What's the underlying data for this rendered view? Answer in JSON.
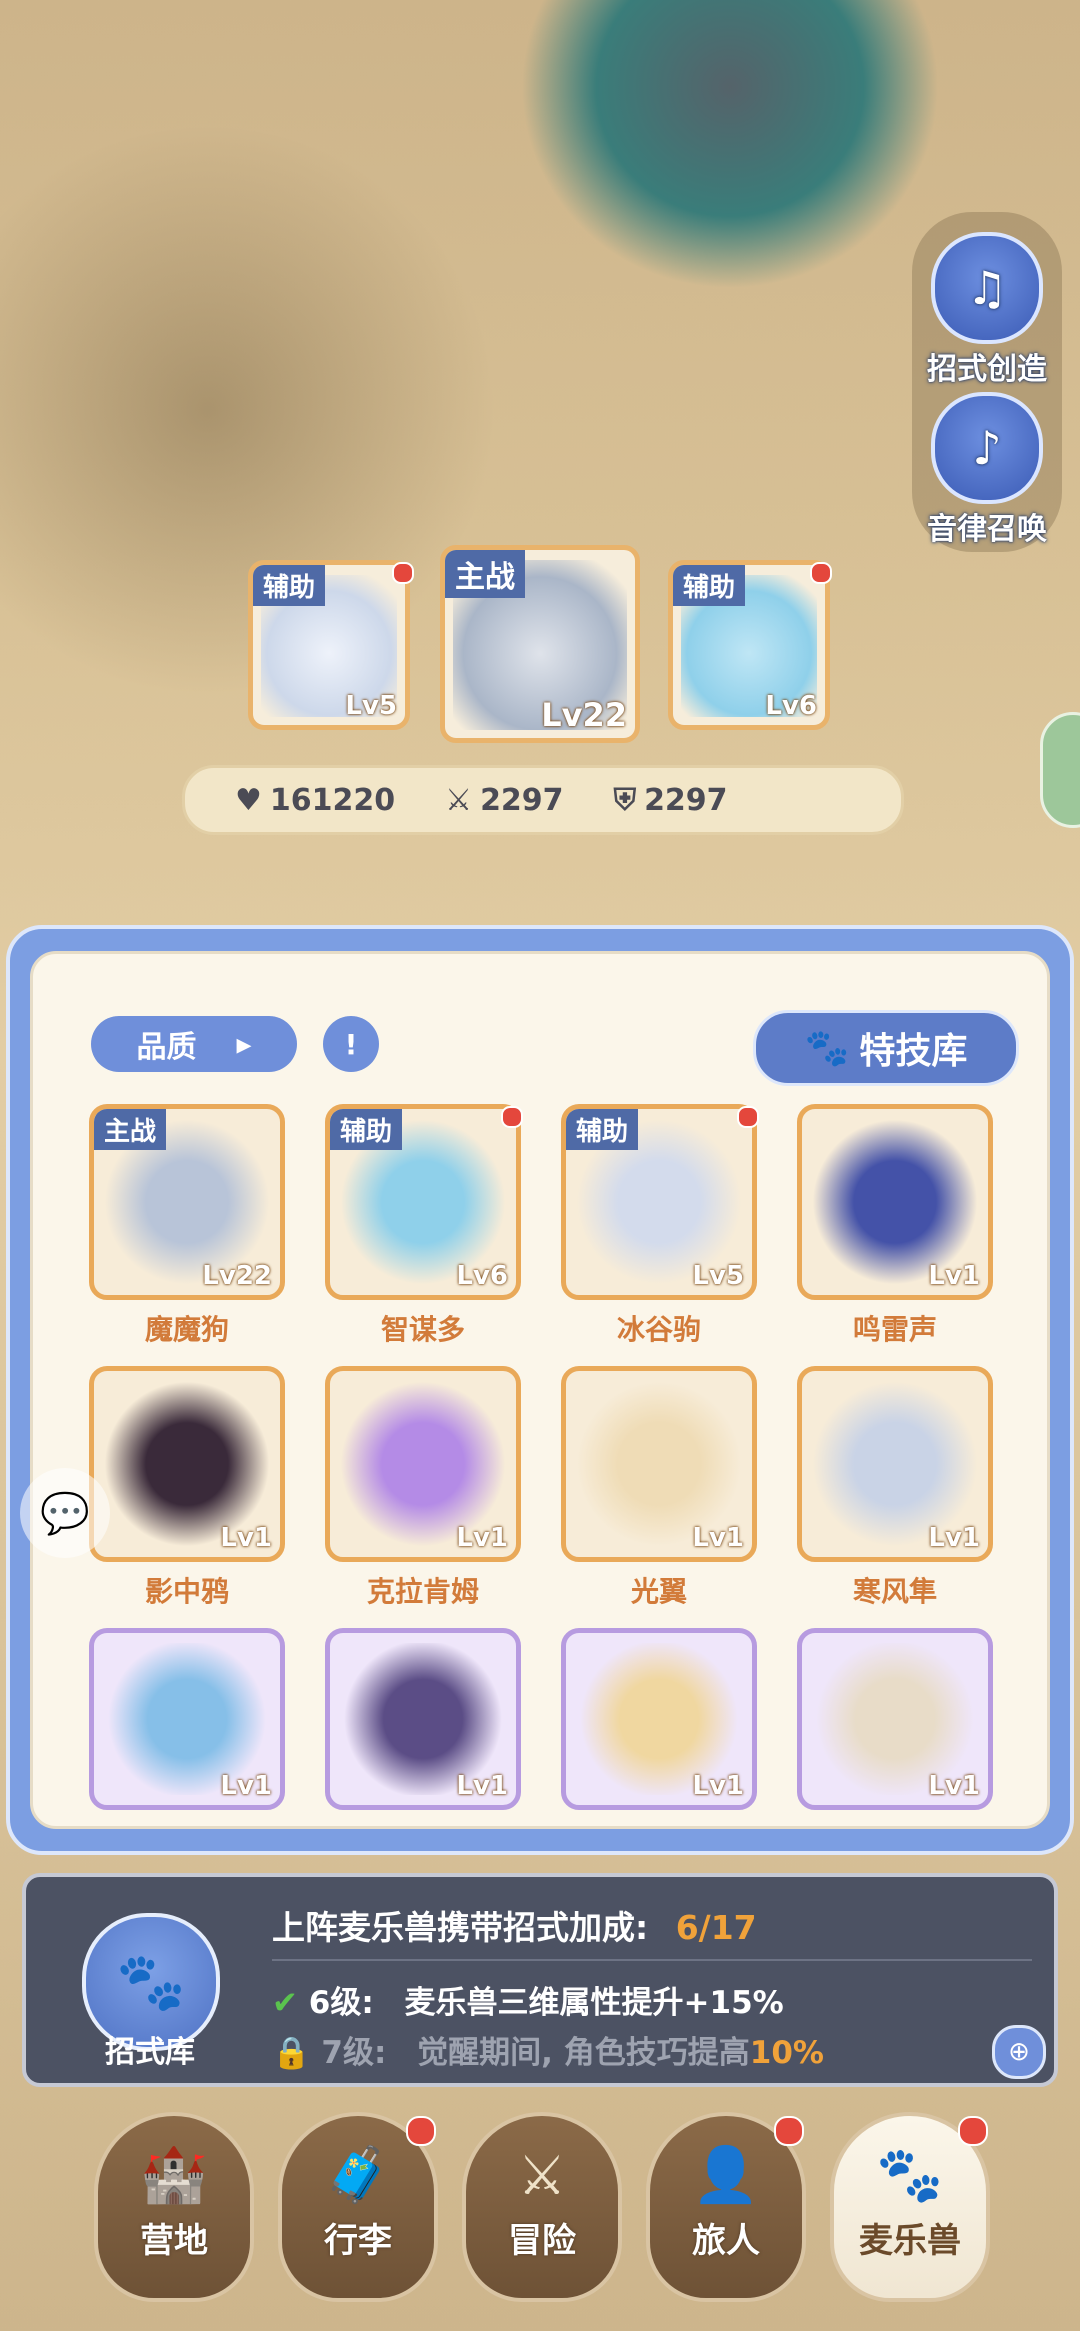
{
  "side_buttons": [
    {
      "label": "招式创造",
      "icon": "book-music-icon"
    },
    {
      "label": "音律召唤",
      "icon": "lyre-icon"
    }
  ],
  "team": [
    {
      "tag": "辅助",
      "level": "Lv5",
      "red_dot": true
    },
    {
      "tag": "主战",
      "level": "Lv22",
      "red_dot": false
    },
    {
      "tag": "辅助",
      "level": "Lv6",
      "red_dot": true
    }
  ],
  "stats": {
    "hp": "161220",
    "attack": "2297",
    "defense": "2297"
  },
  "panel": {
    "sort_label": "品质",
    "skill_library": "特技库"
  },
  "pets": [
    {
      "name": "魔魔狗",
      "level": "Lv22",
      "tag": "主战",
      "rarity": "orange",
      "red_dot": false,
      "art": "#b8c4d8"
    },
    {
      "name": "智谋多",
      "level": "Lv6",
      "tag": "辅助",
      "rarity": "orange",
      "red_dot": true,
      "art": "#8fd0ea"
    },
    {
      "name": "冰谷驹",
      "level": "Lv5",
      "tag": "辅助",
      "rarity": "orange",
      "red_dot": true,
      "art": "#d3dbec"
    },
    {
      "name": "鸣雷声",
      "level": "Lv1",
      "tag": "",
      "rarity": "orange",
      "red_dot": false,
      "art": "#4452a8"
    },
    {
      "name": "影中鸦",
      "level": "Lv1",
      "tag": "",
      "rarity": "orange",
      "red_dot": false,
      "art": "#3a2a3a"
    },
    {
      "name": "克拉肯姆",
      "level": "Lv1",
      "tag": "",
      "rarity": "orange",
      "red_dot": false,
      "art": "#b48be6"
    },
    {
      "name": "光翼",
      "level": "Lv1",
      "tag": "",
      "rarity": "orange",
      "red_dot": false,
      "art": "#efdcb6"
    },
    {
      "name": "寒风隼",
      "level": "Lv1",
      "tag": "",
      "rarity": "orange",
      "red_dot": false,
      "art": "#c9d3e6"
    },
    {
      "name": "",
      "level": "Lv1",
      "tag": "",
      "rarity": "purple",
      "red_dot": false,
      "art": "#86bfe8"
    },
    {
      "name": "",
      "level": "Lv1",
      "tag": "",
      "rarity": "purple",
      "red_dot": false,
      "art": "#5b4d86"
    },
    {
      "name": "",
      "level": "Lv1",
      "tag": "",
      "rarity": "purple",
      "red_dot": false,
      "art": "#f0d7a0"
    },
    {
      "name": "",
      "level": "Lv1",
      "tag": "",
      "rarity": "purple",
      "red_dot": false,
      "art": "#e8dcc8"
    }
  ],
  "bonus": {
    "title": "上阵麦乐兽携带招式加成:",
    "progress": "6/17",
    "lines": [
      {
        "level": "6级:",
        "text": "麦乐兽三维属性提升+15%",
        "unlocked": true
      },
      {
        "level": "7级:",
        "text": "觉醒期间, 角色技巧提高",
        "highlight": "10%",
        "unlocked": false
      }
    ],
    "library_label": "招式库"
  },
  "nav": [
    {
      "label": "营地",
      "icon": "castle-icon",
      "red_dot": false
    },
    {
      "label": "行李",
      "icon": "chest-icon",
      "red_dot": true
    },
    {
      "label": "冒险",
      "icon": "crossed-swords-icon",
      "red_dot": false
    },
    {
      "label": "旅人",
      "icon": "character-icon",
      "red_dot": true
    },
    {
      "label": "麦乐兽",
      "icon": "pet-icon",
      "red_dot": true,
      "active": true
    }
  ],
  "colors": {
    "accent": "#6f8fda",
    "orange_frame": "#e9a959",
    "purple_frame": "#b79be0",
    "name_text": "#d27b3a",
    "highlight": "#f0a23a"
  }
}
